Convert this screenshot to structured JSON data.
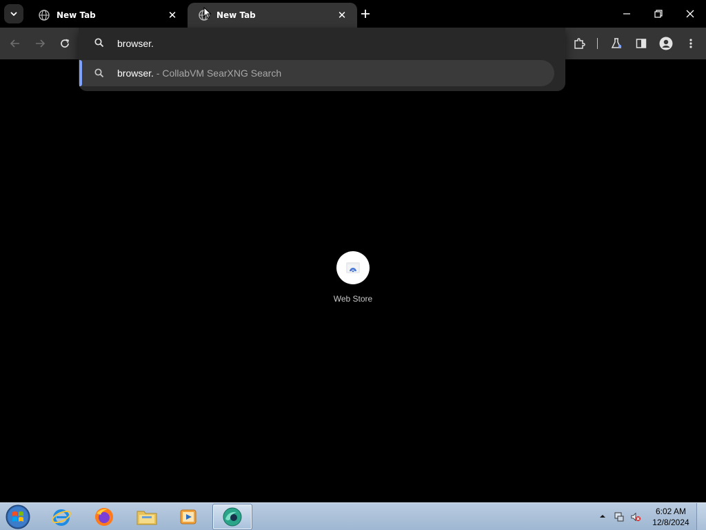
{
  "tabs": [
    {
      "title": "New Tab",
      "state": "inactive"
    },
    {
      "title": "New Tab",
      "state": "active"
    }
  ],
  "omnibox": {
    "value": "browser.",
    "suggestion": {
      "query": "browser.",
      "separator": " - ",
      "engine": "CollabVM SearXNG Search"
    }
  },
  "shortcut": {
    "label": "Web Store"
  },
  "taskbar": {
    "apps": [
      "internet-explorer",
      "firefox",
      "file-explorer",
      "media-player",
      "chrome-browser"
    ],
    "clock": {
      "time": "6:02 AM",
      "date": "12/8/2024"
    }
  },
  "colors": {
    "accent": "#7fa2ff",
    "toolbar": "#353535",
    "popup": "#282828",
    "taskbar": "#a9bfd8"
  }
}
